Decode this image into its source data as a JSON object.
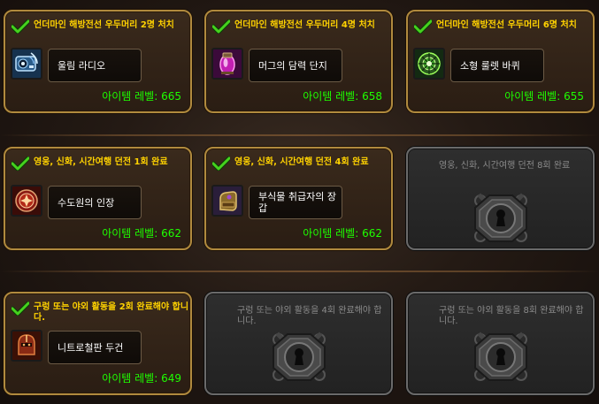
{
  "ilvl_label": "아이템 레벨:",
  "cards": [
    {
      "state": "complete",
      "condition": "언더마인 해방전선 우두머리 2명 처치",
      "item": "울림 라디오",
      "icon": "echo-radio-icon",
      "ilvl": "665"
    },
    {
      "state": "complete",
      "condition": "언더마인 해방전선 우두머리 4명 처치",
      "item": "머그의 담력 단지",
      "icon": "mug-moxie-jar-icon",
      "ilvl": "658"
    },
    {
      "state": "complete",
      "condition": "언더마인 해방전선 우두머리 6명 처치",
      "item": "소형 룰렛 바퀴",
      "icon": "roulette-wheel-icon",
      "ilvl": "655"
    },
    {
      "state": "complete",
      "condition": "영웅, 신화, 시간여행 던전 1회 완료",
      "item": "수도원의 인장",
      "icon": "priory-signet-icon",
      "ilvl": "662"
    },
    {
      "state": "complete",
      "condition": "영웅, 신화, 시간여행 던전 4회 완료",
      "item": "부식물 취급자의 장갑",
      "icon": "gauntlet-icon",
      "ilvl": "662"
    },
    {
      "state": "locked",
      "condition": "영웅, 신화, 시간여행 던전 8회 완료",
      "icon": "lock-icon"
    },
    {
      "state": "complete",
      "condition": "구렁 또는 야외 활동을 2회 완료해야 합니다.",
      "item": "니트로철판 두건",
      "icon": "helm-icon",
      "ilvl": "649"
    },
    {
      "state": "locked",
      "condition": "구렁 또는 야외 활동을 4회 완료해야 합니다.",
      "icon": "lock-icon"
    },
    {
      "state": "locked",
      "condition": "구렁 또는 야외 활동을 8회 완료해야 합니다.",
      "icon": "lock-icon"
    }
  ],
  "colors": {
    "complete_border": "#b08a3e",
    "condition_complete": "#ffd200",
    "condition_locked": "#8a8a8a",
    "item_level": "#1eff00",
    "check": "#46d11e"
  }
}
